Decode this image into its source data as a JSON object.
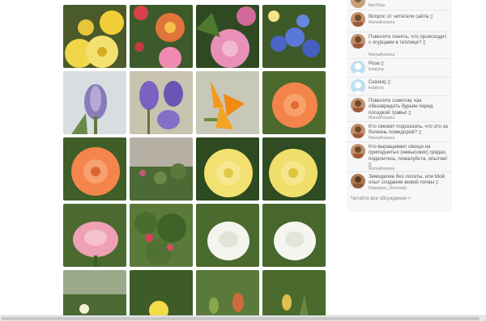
{
  "gallery": {
    "photos": [
      {
        "name": "yellow-chrysanthemums-photo"
      },
      {
        "name": "red-dahlias-photo"
      },
      {
        "name": "pink-dahlia-photo"
      },
      {
        "name": "blue-scilla-photo"
      },
      {
        "name": "purple-crocus-in-snow-photo"
      },
      {
        "name": "purple-crocuses-photo"
      },
      {
        "name": "orange-crocus-photo"
      },
      {
        "name": "orange-rose-photo"
      },
      {
        "name": "orange-rose-photo-2"
      },
      {
        "name": "flower-bed-photo"
      },
      {
        "name": "yellow-rose-photo"
      },
      {
        "name": "yellow-rose-photo-2"
      },
      {
        "name": "pink-rose-photo"
      },
      {
        "name": "peony-bush-photo"
      },
      {
        "name": "white-rose-photo"
      },
      {
        "name": "white-rose-photo-2"
      },
      {
        "name": "garden-path-photo"
      },
      {
        "name": "yellow-flower-photo"
      },
      {
        "name": "green-tulips-photo"
      },
      {
        "name": "tulip-leaves-photo"
      }
    ]
  },
  "sidebar": {
    "items": [
      {
        "title": "",
        "author": "MarOlsia",
        "avatar": "photo"
      },
      {
        "title": "Вопрос от читателя сайта ▯",
        "author": "MamaRowana",
        "avatar": "photo"
      },
      {
        "title": "Помогите понять, что происходит с огурцами в теплице? ▯",
        "author": "MamaRowana",
        "avatar": "photo"
      },
      {
        "title": "Роза ▯",
        "author": "kstatyna",
        "avatar": "default"
      },
      {
        "title": "Сказка) ▯",
        "author": "kstatyna",
        "avatar": "default"
      },
      {
        "title": "Помогите советом, как обеззвредить бурьян перед посадкой травы! ▯",
        "author": "MamaRowana",
        "avatar": "photo"
      },
      {
        "title": "Кто сможет подсказать, что это за болезнь помидоров? ▯",
        "author": "MamaRowana",
        "avatar": "photo"
      },
      {
        "title": "Кто выращивает овощи на приподнятых (невысоких) грядах, поделитесь, пожалуйста, опытом! ▯",
        "author": "MamaRowana",
        "avatar": "photo"
      },
      {
        "title": "Земеделие без лопаты, или Мой опыт создания живой почвы ▯",
        "author": "Rapqopov_Gennadiy",
        "avatar": "photo2"
      }
    ],
    "all_discussions_link": "Читайте все обсуждения >"
  },
  "colors": {
    "sidebar_bg": "#f7f7f7",
    "link": "#7a8a78",
    "text": "#555555",
    "author": "#8a8a8a"
  }
}
